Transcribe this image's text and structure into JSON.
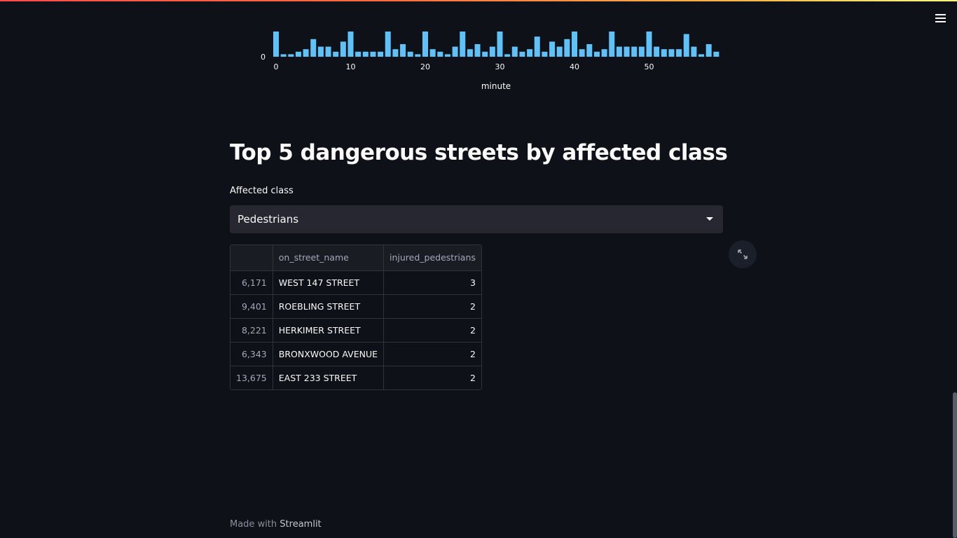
{
  "app": {
    "menu_icon": "hamburger-menu-icon",
    "accent_gradient": [
      "#ff4b4b",
      "#ffbd45",
      "#fffd80"
    ]
  },
  "chart_data": {
    "type": "bar",
    "xlabel": "minute",
    "ylabel": "",
    "x": [
      0,
      1,
      2,
      3,
      4,
      5,
      6,
      7,
      8,
      9,
      10,
      11,
      12,
      13,
      14,
      15,
      16,
      17,
      18,
      19,
      20,
      21,
      22,
      23,
      24,
      25,
      26,
      27,
      28,
      29,
      30,
      31,
      32,
      33,
      34,
      35,
      36,
      37,
      38,
      39,
      40,
      41,
      42,
      43,
      44,
      45,
      46,
      47,
      48,
      49,
      50,
      51,
      52,
      53,
      54,
      55,
      56,
      57,
      58,
      59
    ],
    "values": [
      10,
      1,
      1,
      2,
      3,
      7,
      4,
      4,
      2,
      6,
      10,
      2,
      2,
      2,
      2,
      10,
      3,
      5,
      2,
      1,
      10,
      3,
      2,
      1,
      4,
      10,
      3,
      5,
      2,
      4,
      10,
      1,
      4,
      2,
      3,
      8,
      2,
      6,
      4,
      7,
      10,
      3,
      5,
      2,
      3,
      10,
      4,
      4,
      4,
      4,
      10,
      4,
      3,
      3,
      3,
      9,
      4,
      1,
      5,
      2
    ],
    "x_ticks": [
      0,
      10,
      20,
      30,
      40,
      50
    ],
    "y_ticks": [
      0
    ],
    "bar_color": "#5ec1f7"
  },
  "section": {
    "title": "Top 5 dangerous streets by affected class",
    "select_label": "Affected class",
    "select_value": "Pedestrians",
    "select_icon": "caret-down-icon"
  },
  "table": {
    "columns": [
      "",
      "on_street_name",
      "injured_pedestrians"
    ],
    "rows": [
      {
        "index": "6,171",
        "street": "WEST 147 STREET",
        "injured": "3"
      },
      {
        "index": "9,401",
        "street": "ROEBLING STREET",
        "injured": "2"
      },
      {
        "index": "8,221",
        "street": "HERKIMER STREET",
        "injured": "2"
      },
      {
        "index": "6,343",
        "street": "BRONXWOOD AVENUE",
        "injured": "2"
      },
      {
        "index": "13,675",
        "street": "EAST 233 STREET",
        "injured": "2"
      }
    ],
    "expand_icon": "expand-icon"
  },
  "footer": {
    "prefix": "Made with",
    "brand": "Streamlit"
  }
}
